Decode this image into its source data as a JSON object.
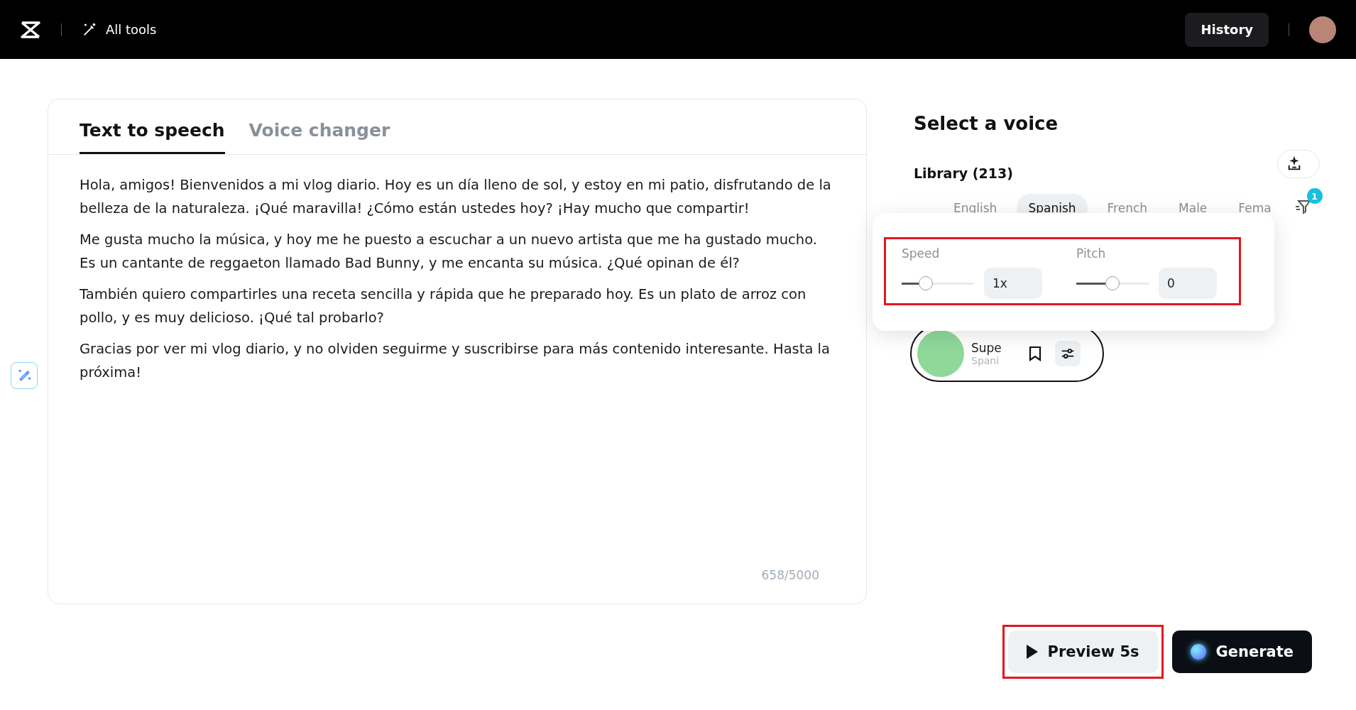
{
  "top_bar": {
    "tools_label": "All tools",
    "history_button": "History"
  },
  "editor": {
    "tabs": [
      {
        "label": "Text to speech",
        "selected": true
      },
      {
        "label": "Voice changer",
        "selected": false
      }
    ],
    "paragraphs": [
      "Hola, amigos! Bienvenidos a mi vlog diario. Hoy es un día lleno de sol, y estoy en mi patio, disfrutando de la belleza de la naturaleza. ¡Qué maravilla! ¿Cómo están ustedes hoy? ¡Hay mucho que compartir!",
      "Me gusta mucho la música, y hoy me he puesto a escuchar a un nuevo artista que me ha gustado mucho. Es un cantante de reggaeton llamado Bad Bunny, y me encanta su música. ¿Qué opinan de él?",
      "También quiero compartirles una receta sencilla y rápida que he preparado hoy. Es un plato de arroz con pollo, y es muy delicioso. ¡Qué tal probarlo?",
      "Gracias por ver mi vlog diario, y no olviden seguirme y suscribirse para más contenido interesante. Hasta la próxima!"
    ],
    "char_count": "658/5000"
  },
  "voice_panel": {
    "title": "Select a voice",
    "library": "Library (213)",
    "filters": [
      {
        "label": "English",
        "selected": false
      },
      {
        "label": "Spanish",
        "selected": true
      },
      {
        "label": "French",
        "selected": false
      },
      {
        "label": "Male",
        "selected": false
      },
      {
        "label": "Fema",
        "selected": false
      }
    ],
    "filter_badge": "1",
    "voice": {
      "name": "Supe",
      "language": "Spani"
    },
    "settings_popover": {
      "highlighted": true,
      "controls": [
        {
          "label": "Speed",
          "level": 0.33,
          "value": "1x"
        },
        {
          "label": "Pitch",
          "level": 0.5,
          "value": "0"
        }
      ]
    }
  },
  "actions": {
    "preview": {
      "label": "Preview 5s",
      "highlighted": true
    },
    "generate": "Generate"
  }
}
